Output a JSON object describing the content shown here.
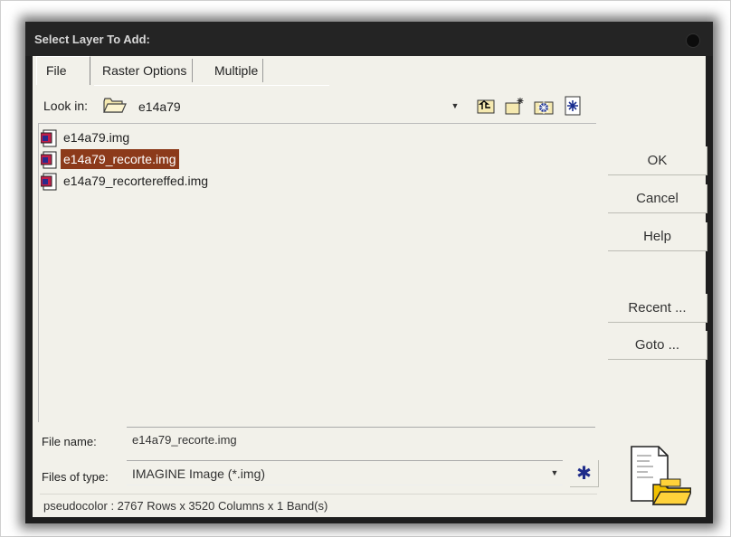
{
  "window": {
    "title": "Select Layer To Add:"
  },
  "tabs": [
    {
      "label": "File"
    },
    {
      "label": "Raster Options"
    },
    {
      "label": "Multiple"
    }
  ],
  "look_in": {
    "label": "Look in:",
    "value": "e14a79",
    "icon": "folder-icon"
  },
  "toolbar_icons": [
    "up-one-level-icon",
    "new-folder-icon",
    "connect-icon",
    "spatial-filter-icon"
  ],
  "files": [
    {
      "name": "e14a79.img",
      "selected": false
    },
    {
      "name": "e14a79_recorte.img",
      "selected": true
    },
    {
      "name": "e14a79_recortereffed.img",
      "selected": false
    }
  ],
  "buttons": {
    "ok": "OK",
    "cancel": "Cancel",
    "help": "Help",
    "recent": "Recent ...",
    "goto": "Goto ..."
  },
  "file_name": {
    "label": "File name:",
    "value": "e14a79_recorte.img"
  },
  "files_of_type": {
    "label": "Files of type:",
    "value": "IMAGINE Image (*.img)"
  },
  "status": "pseudocolor : 2767 Rows x 3520 Columns x 1 Band(s)",
  "colors": {
    "selection": "#8c3a1a",
    "dialog_bg": "#f2f1ea",
    "titlebar": "#242424"
  }
}
